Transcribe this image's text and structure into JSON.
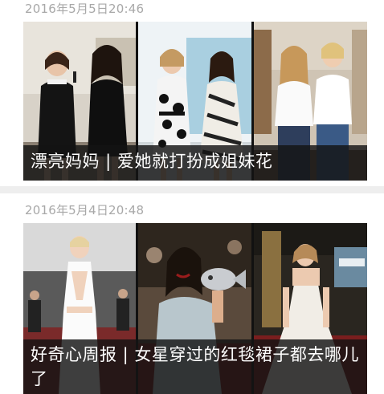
{
  "feed": {
    "articles": [
      {
        "timestamp": "2016年5月5日20:46",
        "headline": "漂亮妈妈 | 爱她就打扮成姐妹花",
        "images": [
          {
            "alt": "two women in black dresses at an event"
          },
          {
            "alt": "two women in black-and-white patterned dresses"
          },
          {
            "alt": "two women in white shirts and jeans"
          }
        ]
      },
      {
        "timestamp": "2016年5月4日20:48",
        "headline": "好奇心周报 | 女星穿过的红毯裙子都去哪儿了",
        "images": [
          {
            "alt": "model in white cut-out gown on red carpet"
          },
          {
            "alt": "actress in pale blue gown holding a silver fish clutch"
          },
          {
            "alt": "actress in white strapless ball gown at the Oscars"
          }
        ]
      }
    ]
  }
}
